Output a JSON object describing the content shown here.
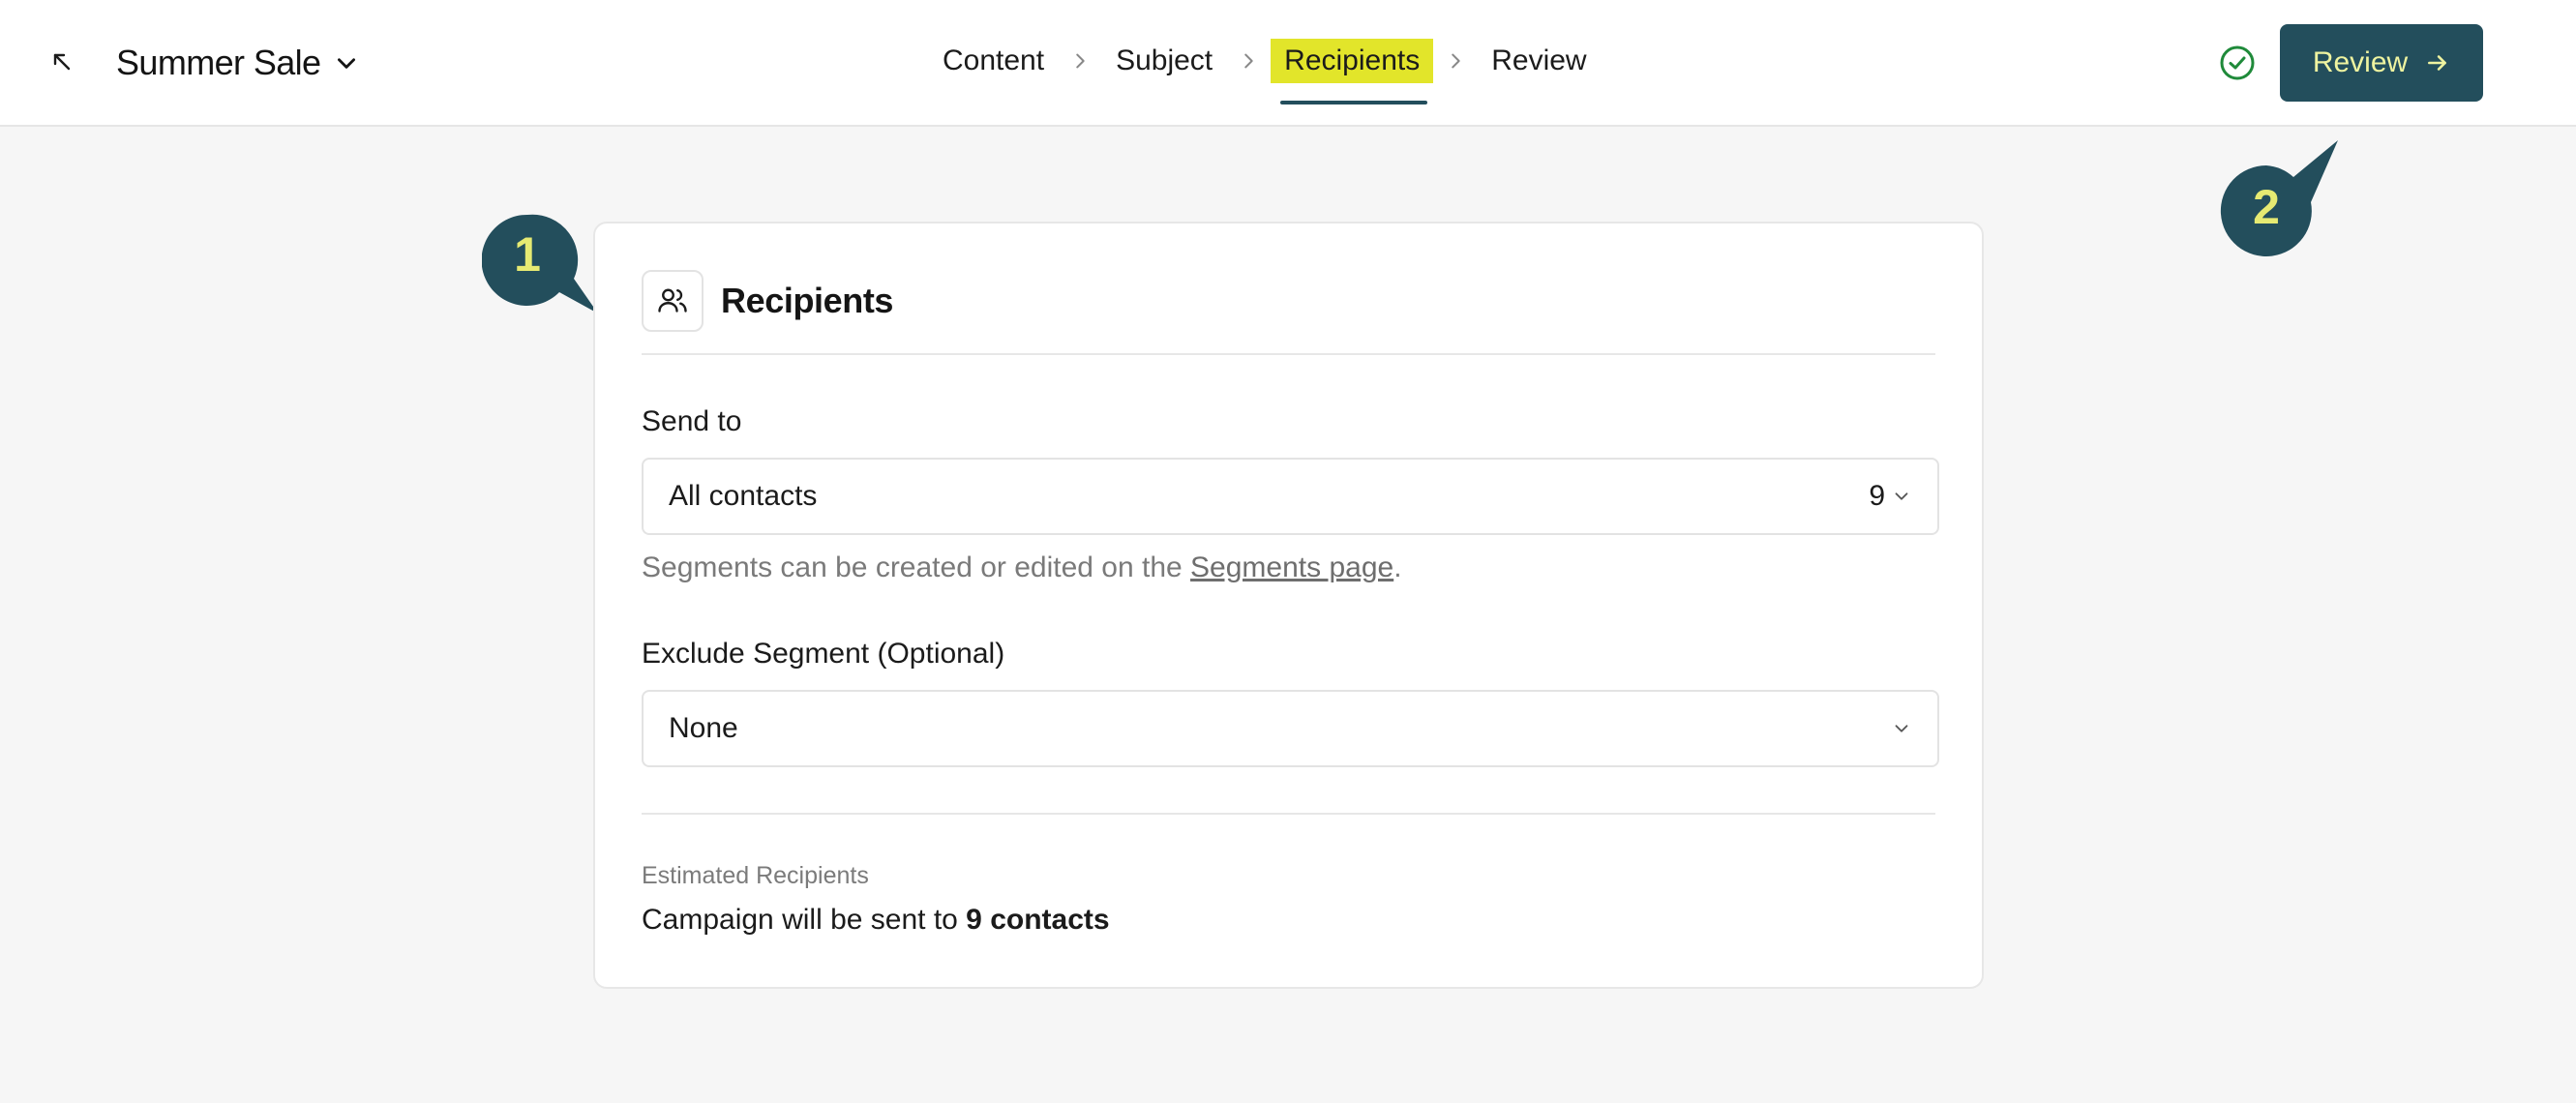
{
  "header": {
    "campaign_name": "Summer Sale",
    "steps": [
      {
        "label": "Content",
        "active": false
      },
      {
        "label": "Subject",
        "active": false
      },
      {
        "label": "Recipients",
        "active": true
      },
      {
        "label": "Review",
        "active": false
      }
    ],
    "review_button_label": "Review",
    "accent_color": "#234e5c",
    "highlight_color": "#e2e52a"
  },
  "callouts": [
    {
      "number": "1"
    },
    {
      "number": "2"
    }
  ],
  "recipients_card": {
    "title": "Recipients",
    "send_to": {
      "label": "Send to",
      "selected": "All contacts",
      "count": "9"
    },
    "helper": {
      "prefix": "Segments can be created or edited on the ",
      "link": "Segments page",
      "suffix": "."
    },
    "exclude": {
      "label": "Exclude Segment (Optional)",
      "selected": "None"
    },
    "estimate": {
      "label": "Estimated Recipients",
      "prefix": "Campaign will be sent to ",
      "count_text": "9 contacts"
    }
  }
}
